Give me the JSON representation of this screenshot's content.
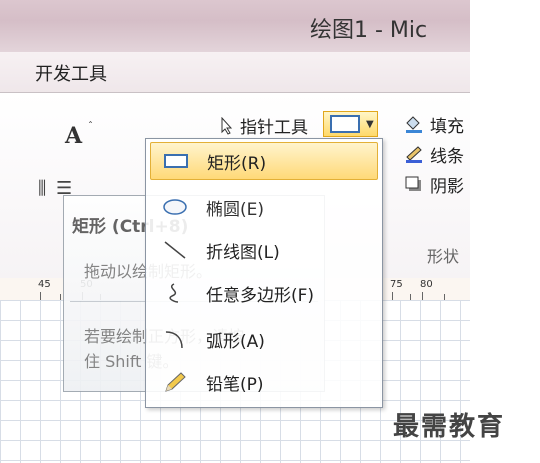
{
  "window": {
    "title": "绘图1 - Mic"
  },
  "ribbon_tab": "开发工具",
  "ribbon": {
    "pointer_tool_label": "指针工具",
    "fill_label": "填充",
    "line_label": "线条",
    "shadow_label": "阴影",
    "group_label": "形状"
  },
  "ruler": {
    "labels": [
      "45",
      "50",
      "75",
      "80"
    ]
  },
  "tooltip": {
    "title": "矩形 (Ctrl+8)",
    "description": "拖动以绘制矩形。",
    "tip_line1": "若要绘制正方形，请按",
    "tip_line2": "住 Shift 键。"
  },
  "menu": {
    "items": [
      {
        "label": "矩形(R)",
        "icon": "rectangle-icon",
        "selected": true
      },
      {
        "label": "椭圆(E)",
        "icon": "ellipse-icon",
        "selected": false
      },
      {
        "label": "折线图(L)",
        "icon": "line-icon",
        "selected": false
      },
      {
        "label": "任意多边形(F)",
        "icon": "freeform-icon",
        "selected": false
      },
      {
        "label": "弧形(A)",
        "icon": "arc-icon",
        "selected": false
      },
      {
        "label": "铅笔(P)",
        "icon": "pencil-icon",
        "selected": false
      }
    ]
  },
  "watermark": "最需教育",
  "colors": {
    "accent_selected": "#ffd978",
    "selected_border": "#e3b037",
    "rect_icon": "#3a6fb0"
  }
}
